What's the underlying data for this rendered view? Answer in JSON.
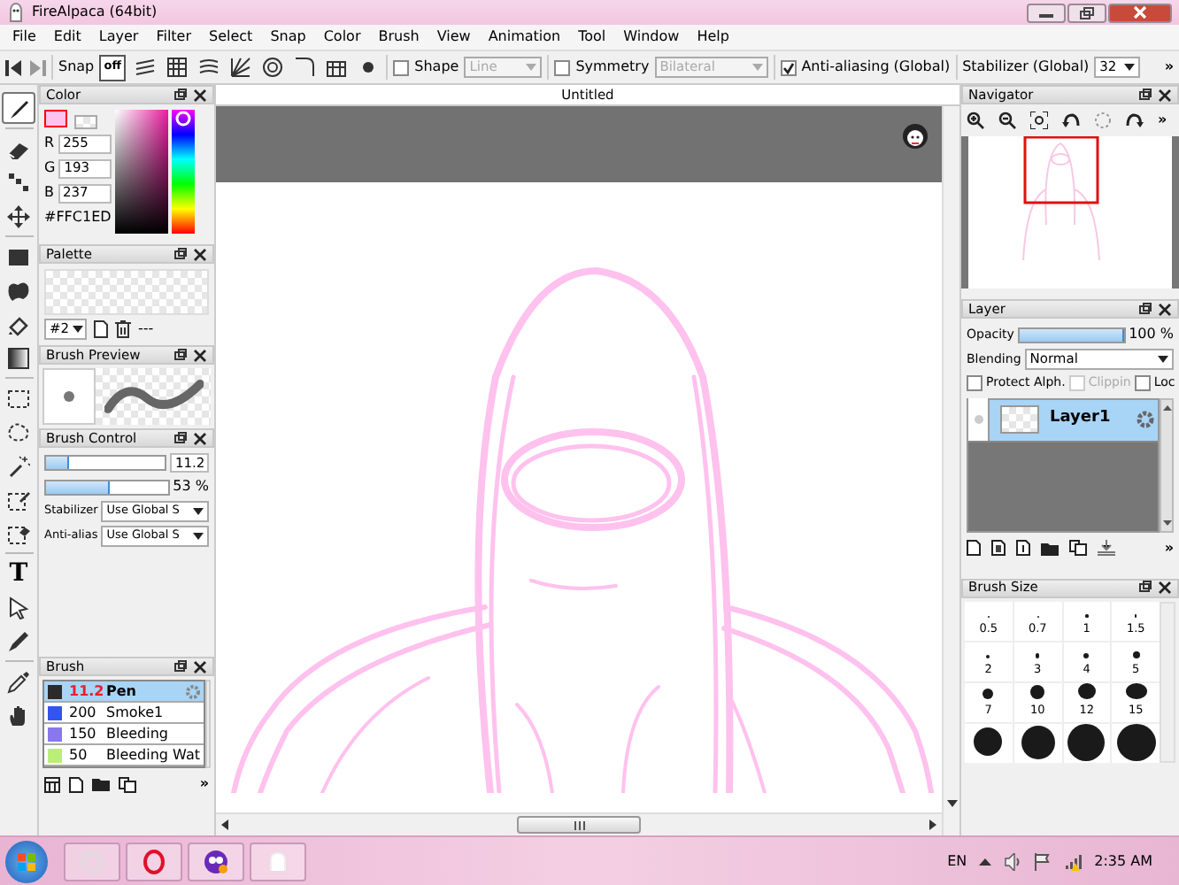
{
  "window": {
    "title": "FireAlpaca (64bit)"
  },
  "menu": [
    "File",
    "Edit",
    "Layer",
    "Filter",
    "Select",
    "Snap",
    "Color",
    "Brush",
    "View",
    "Animation",
    "Tool",
    "Window",
    "Help"
  ],
  "toolbar": {
    "snap_label": "Snap",
    "snap_modes": [
      {
        "kind": "off",
        "label": "off",
        "selected": true
      },
      {
        "kind": "parallel",
        "selected": false
      },
      {
        "kind": "grid",
        "selected": false
      },
      {
        "kind": "curves",
        "selected": false
      },
      {
        "kind": "radial",
        "selected": false
      },
      {
        "kind": "circle",
        "selected": false
      },
      {
        "kind": "curve",
        "selected": false
      },
      {
        "kind": "perspective",
        "selected": false
      },
      {
        "kind": "dot",
        "selected": false
      }
    ],
    "shape": {
      "label": "Shape",
      "checked": false,
      "value": "Line",
      "disabled": true
    },
    "symmetry": {
      "label": "Symmetry",
      "checked": false,
      "value": "Bilateral",
      "disabled": true
    },
    "antialiasing": {
      "label": "Anti-aliasing (Global)",
      "checked": true
    },
    "stabilizer": {
      "label": "Stabilizer (Global)",
      "value": "32"
    },
    "overflow": "»"
  },
  "tools": [
    {
      "kind": "brush",
      "selected": true
    },
    {
      "kind": "eraser",
      "selected": false
    },
    {
      "kind": "dot",
      "selected": false
    },
    {
      "kind": "move",
      "selected": false
    },
    {
      "kind": "fill",
      "selected": false
    },
    {
      "kind": "blob",
      "selected": false
    },
    {
      "kind": "bucket",
      "selected": false
    },
    {
      "kind": "gradient",
      "selected": false
    },
    {
      "kind": "select",
      "selected": false
    },
    {
      "kind": "lasso",
      "selected": false
    },
    {
      "kind": "wand",
      "selected": false
    },
    {
      "kind": "select-pen",
      "selected": false
    },
    {
      "kind": "select-eraser",
      "selected": false
    },
    {
      "kind": "text",
      "glyph": "T",
      "selected": false
    },
    {
      "kind": "cursor",
      "selected": false
    },
    {
      "kind": "pen",
      "selected": false
    },
    {
      "kind": "eyedropper",
      "selected": false
    },
    {
      "kind": "hand",
      "selected": false
    }
  ],
  "color_panel": {
    "title": "Color",
    "color": "#ffc1ed",
    "channels": [
      {
        "label": "R",
        "value": "255"
      },
      {
        "label": "G",
        "value": "193"
      },
      {
        "label": "B",
        "value": "237"
      }
    ],
    "hex": "#FFC1ED"
  },
  "palette_panel": {
    "title": "Palette",
    "set": "#2",
    "more": "---"
  },
  "brush_preview_panel": {
    "title": "Brush Preview"
  },
  "brush_control_panel": {
    "title": "Brush Control",
    "size": {
      "level": 0.2,
      "value": "11.2"
    },
    "opacity": {
      "level": 0.53,
      "value": "53 %"
    },
    "settings": [
      {
        "label": "Stabilizer",
        "value": "Use Global S"
      },
      {
        "label": "Anti-alias",
        "value": "Use Global S"
      }
    ]
  },
  "brush_panel": {
    "title": "Brush",
    "brushes": [
      {
        "color": "#2b2b2b",
        "size": "11.2",
        "name": "Pen",
        "selected": true
      },
      {
        "color": "#3355ee",
        "size": "200",
        "name": "Smoke1",
        "selected": false
      },
      {
        "color": "#8877ee",
        "size": "150",
        "name": "Bleeding",
        "selected": false
      },
      {
        "color": "#bbee77",
        "size": "50",
        "name": "Bleeding Wat",
        "selected": false
      }
    ],
    "overflow": "»"
  },
  "canvas": {
    "tab": "Untitled"
  },
  "navigator": {
    "title": "Navigator",
    "overflow": "»"
  },
  "layer_panel": {
    "title": "Layer",
    "opacity": {
      "label": "Opacity",
      "level": 1,
      "value": "100 %"
    },
    "blending": {
      "label": "Blending",
      "value": "Normal"
    },
    "options": [
      {
        "label": "Protect Alph.",
        "checked": false,
        "disabled": false
      },
      {
        "label": "Clippin",
        "checked": false,
        "disabled": true
      },
      {
        "label": "Loc",
        "checked": false,
        "disabled": false
      }
    ],
    "layers": [
      {
        "name": "Layer1",
        "selected": true
      }
    ],
    "overflow": "»"
  },
  "brush_size_panel": {
    "title": "Brush Size",
    "sizes": [
      {
        "label": "0.5"
      },
      {
        "label": "0.7"
      },
      {
        "label": "1"
      },
      {
        "label": "1.5"
      },
      {
        "label": "2"
      },
      {
        "label": "3"
      },
      {
        "label": "4"
      },
      {
        "label": "5"
      },
      {
        "label": "7"
      },
      {
        "label": "10"
      },
      {
        "label": "12"
      },
      {
        "label": "15"
      },
      {
        "kind": "unlabeled"
      },
      {
        "kind": "unlabeled"
      },
      {
        "kind": "unlabeled"
      },
      {
        "kind": "unlabeled"
      }
    ]
  },
  "taskbar": {
    "language": "EN",
    "time": "2:35 AM"
  }
}
